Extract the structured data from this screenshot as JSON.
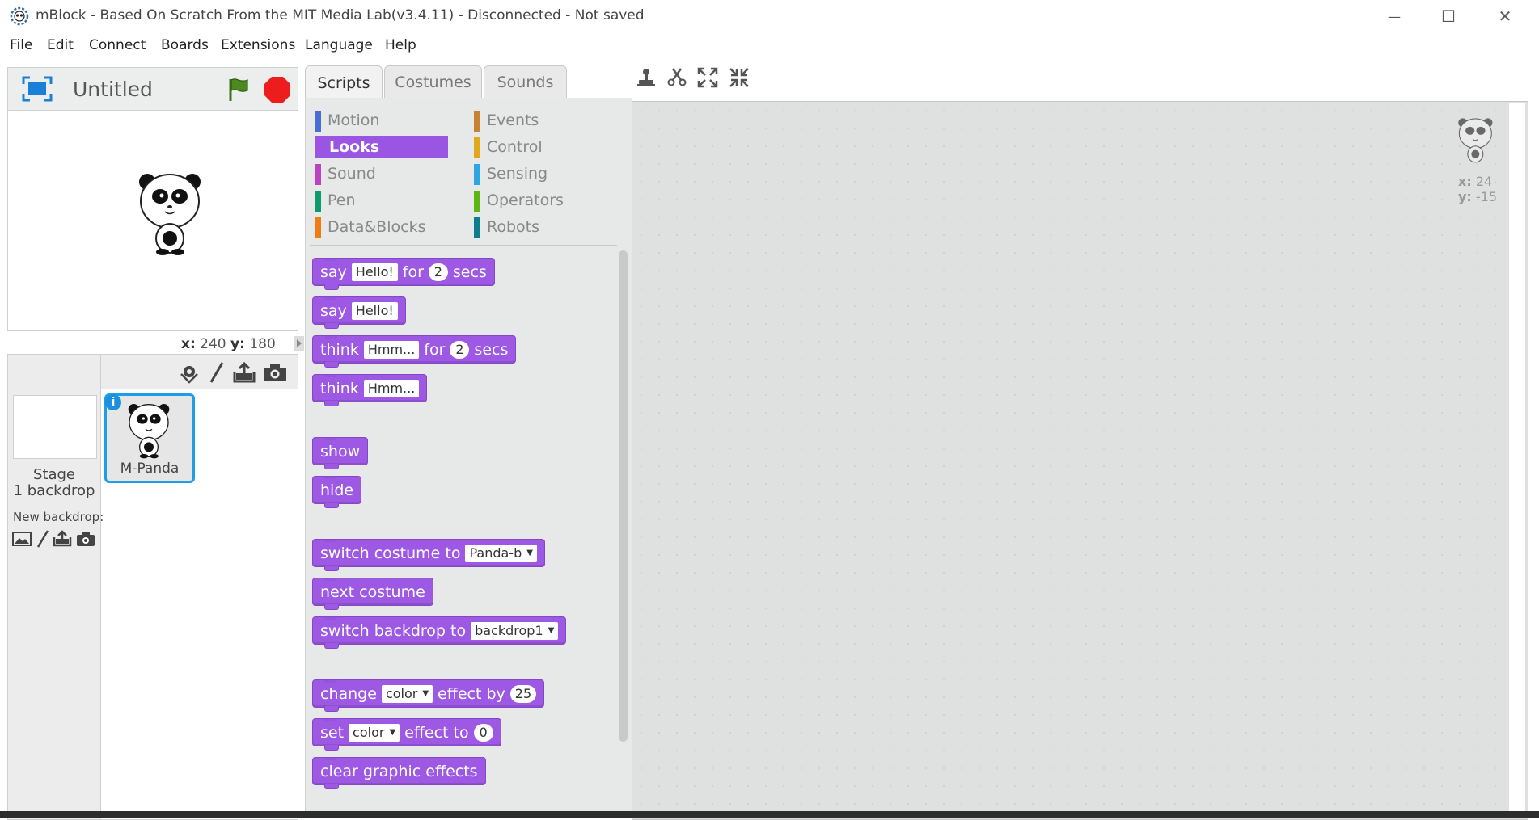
{
  "window": {
    "title": "mBlock - Based On Scratch From the MIT Media Lab(v3.4.11) - Disconnected - Not saved",
    "minimize_glyph": "—",
    "maximize_glyph": "☐",
    "close_glyph": "✕"
  },
  "menu": [
    "File",
    "Edit",
    "Connect",
    "Boards",
    "Extensions",
    "Language",
    "Help"
  ],
  "stage": {
    "project_title": "Untitled",
    "x_label": "x:",
    "x_value": "240",
    "y_label": "y:",
    "y_value": "180"
  },
  "sprite_library": {
    "stage_label": "Stage",
    "backdrop_count": "1 backdrop",
    "new_backdrop_label": "New backdrop:",
    "sprite_name": "M-Panda",
    "info_glyph": "i"
  },
  "tabs": [
    "Scripts",
    "Costumes",
    "Sounds"
  ],
  "categories": [
    {
      "label": "Motion",
      "color": "#4a6cd4",
      "active": false
    },
    {
      "label": "Looks",
      "color": "#8a55d7",
      "active": true
    },
    {
      "label": "Sound",
      "color": "#bb42c3",
      "active": false
    },
    {
      "label": "Pen",
      "color": "#0e9a6c",
      "active": false
    },
    {
      "label": "Data&Blocks",
      "color": "#ee7d16",
      "active": false
    },
    {
      "label": "Events",
      "color": "#c88330",
      "active": false
    },
    {
      "label": "Control",
      "color": "#e1a91a",
      "active": false
    },
    {
      "label": "Sensing",
      "color": "#2ca5e2",
      "active": false
    },
    {
      "label": "Operators",
      "color": "#5cb712",
      "active": false
    },
    {
      "label": "Robots",
      "color": "#0c7f8f",
      "active": false
    }
  ],
  "blocks": {
    "say_for": {
      "say": "say",
      "text": "Hello!",
      "for": "for",
      "secs_val": "2",
      "secs": "secs"
    },
    "say": {
      "say": "say",
      "text": "Hello!"
    },
    "think_for": {
      "think": "think",
      "text": "Hmm...",
      "for": "for",
      "secs_val": "2",
      "secs": "secs"
    },
    "think": {
      "think": "think",
      "text": "Hmm..."
    },
    "show": "show",
    "hide": "hide",
    "switch_costume": {
      "label": "switch costume to",
      "value": "Panda-b"
    },
    "next_costume": "next costume",
    "switch_backdrop": {
      "label": "switch backdrop to",
      "value": "backdrop1"
    },
    "change_effect": {
      "change": "change",
      "effect": "color",
      "by": "effect by",
      "value": "25"
    },
    "set_effect": {
      "set": "set",
      "effect": "color",
      "to": "effect to",
      "value": "0"
    },
    "clear_effects": "clear graphic effects"
  },
  "script_area": {
    "sprite_x_label": "x:",
    "sprite_x": "24",
    "sprite_y_label": "y:",
    "sprite_y": "-15"
  }
}
